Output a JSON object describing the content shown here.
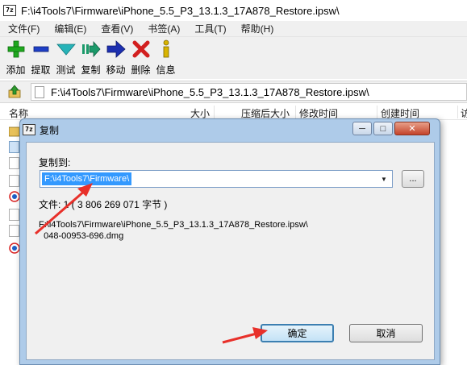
{
  "window": {
    "title": "F:\\i4Tools7\\Firmware\\iPhone_5.5_P3_13.1.3_17A878_Restore.ipsw\\",
    "icon_label": "7z"
  },
  "menu": [
    {
      "label": "文件(F)"
    },
    {
      "label": "编辑(E)"
    },
    {
      "label": "查看(V)"
    },
    {
      "label": "书签(A)"
    },
    {
      "label": "工具(T)"
    },
    {
      "label": "帮助(H)"
    }
  ],
  "toolbar": [
    {
      "label": "添加",
      "icon": "plus-icon",
      "color": "#1fa81f"
    },
    {
      "label": "提取",
      "icon": "minus-icon",
      "color": "#1e3fc6"
    },
    {
      "label": "测试",
      "icon": "check-icon",
      "color": "#27b3b8"
    },
    {
      "label": "复制",
      "icon": "copy-arrow-icon",
      "color": "#1b9a6a"
    },
    {
      "label": "移动",
      "icon": "move-arrow-icon",
      "color": "#1c2fb0"
    },
    {
      "label": "删除",
      "icon": "delete-x-icon",
      "color": "#d21f1f"
    },
    {
      "label": "信息",
      "icon": "info-icon",
      "color": "#d9b400"
    }
  ],
  "address": {
    "path": "F:\\i4Tools7\\Firmware\\iPhone_5.5_P3_13.1.3_17A878_Restore.ipsw\\"
  },
  "columns": [
    {
      "label": "名称"
    },
    {
      "label": "大小"
    },
    {
      "label": "压缩后大小"
    },
    {
      "label": "修改时间"
    },
    {
      "label": "创建时间"
    },
    {
      "label": "访"
    }
  ],
  "dialog": {
    "title": "复制",
    "icon_label": "7z",
    "copy_to_label": "复制到:",
    "destination": "F:\\i4Tools7\\Firmware\\",
    "browse_label": "...",
    "files_info": "文件: 1   ( 3 806 269 071 字节 )",
    "source_path": "F:\\i4Tools7\\Firmware\\iPhone_5.5_P3_13.1.3_17A878_Restore.ipsw\\\n  048-00953-696.dmg",
    "ok_label": "确定",
    "cancel_label": "取消",
    "minimize_label": "─",
    "maximize_label": "□",
    "close_label": "✕"
  },
  "colors": {
    "annotation_arrow": "#e8302a",
    "selection": "#3399ff",
    "dialog_frame": "#aecbe9"
  }
}
